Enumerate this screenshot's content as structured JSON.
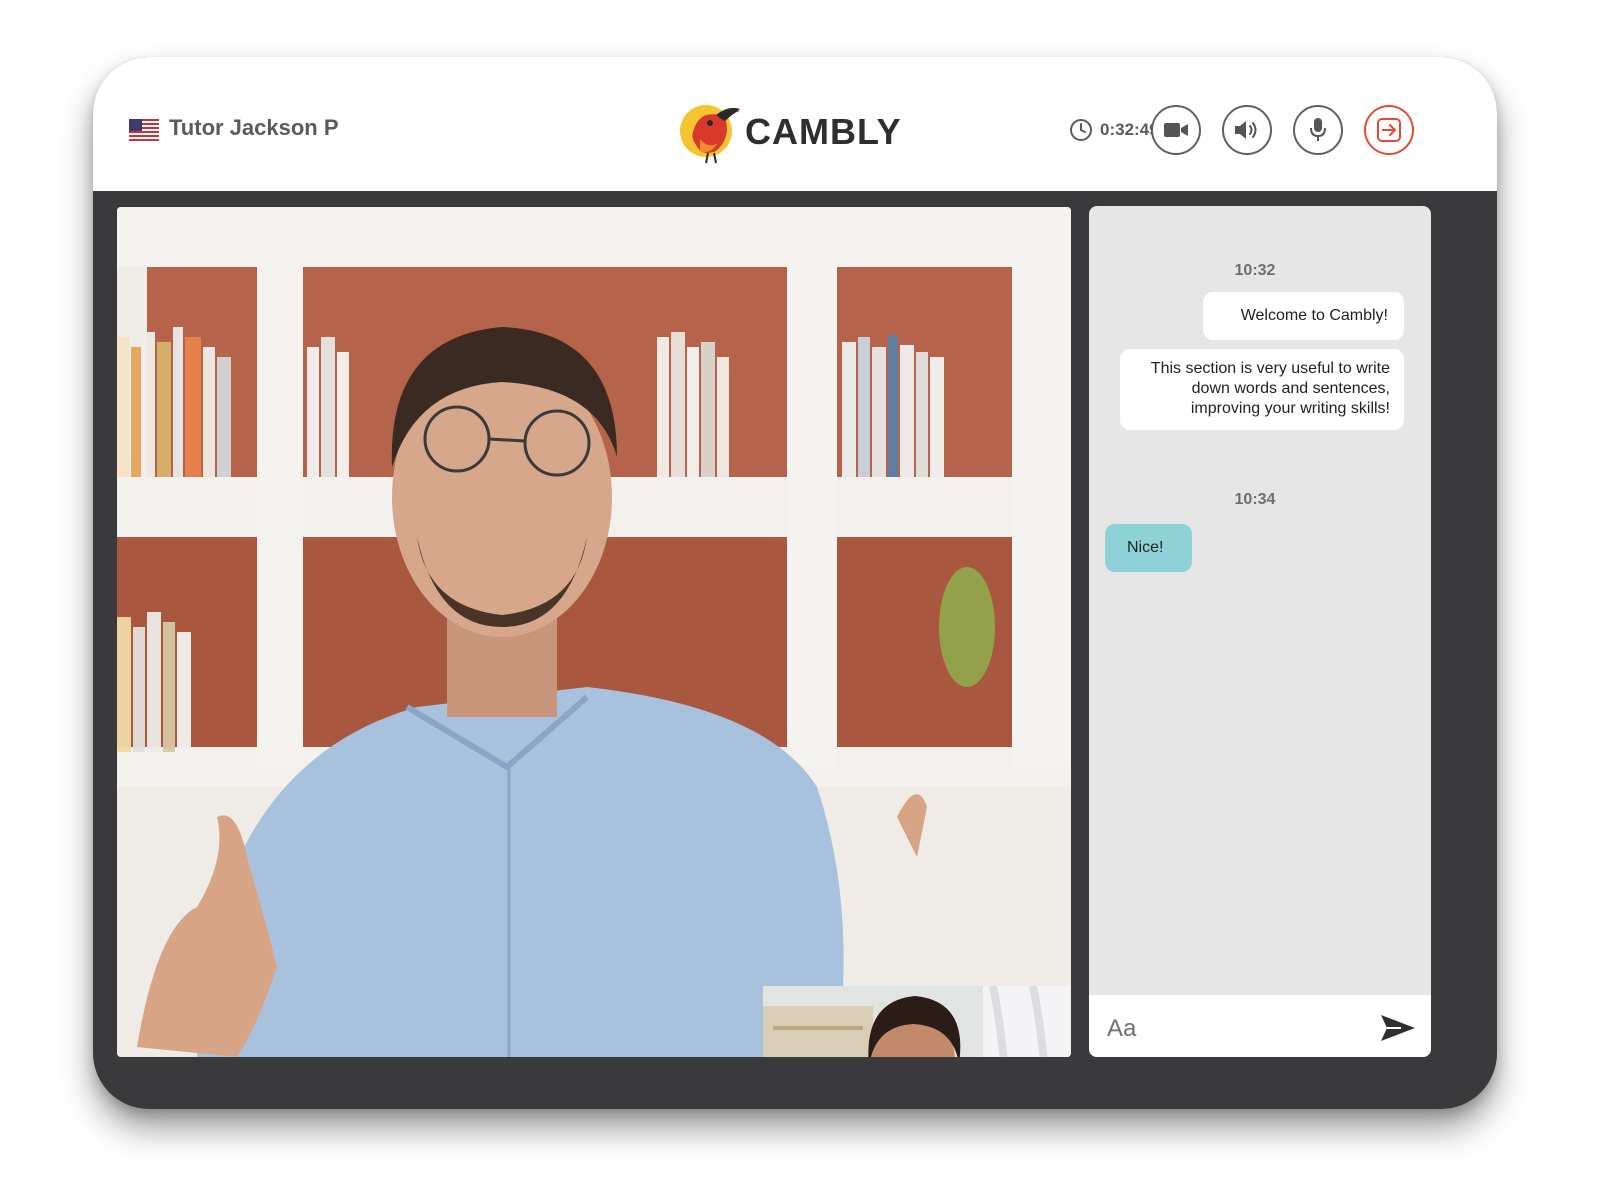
{
  "header": {
    "tutor_name": "Tutor Jackson P",
    "flag_icon": "us-flag-icon",
    "logo_text": "CAMBLY",
    "timer": "0:32:49",
    "controls": [
      {
        "name": "camera-button",
        "icon": "video-camera-icon"
      },
      {
        "name": "speaker-button",
        "icon": "speaker-icon"
      },
      {
        "name": "microphone-button",
        "icon": "microphone-icon"
      },
      {
        "name": "exit-button",
        "icon": "exit-icon",
        "color": "#e64b32"
      }
    ]
  },
  "chat": {
    "groups": [
      {
        "time": "10:32",
        "messages": [
          {
            "side": "out",
            "text": "Welcome to Cambly!"
          },
          {
            "side": "out",
            "lines": [
              "This section is very useful to write",
              "down words and sentences,",
              "improving your writing skills!"
            ]
          }
        ]
      },
      {
        "time": "10:34",
        "messages": [
          {
            "side": "in",
            "text": "Nice!"
          }
        ]
      }
    ],
    "input_placeholder": "Aa",
    "send_icon": "send-icon"
  },
  "colors": {
    "frame": "#3a393b",
    "chat_bg": "#e6e6e6",
    "incoming_bubble": "#8ed1d7",
    "exit_accent": "#e64b32",
    "logo_yellow": "#f4c531",
    "logo_red": "#d8392b"
  }
}
